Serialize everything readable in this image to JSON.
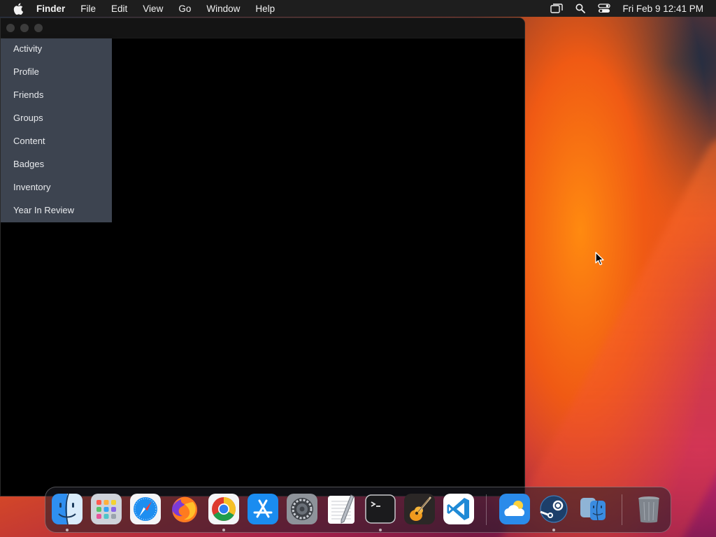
{
  "menubar": {
    "app_name": "Finder",
    "menus": [
      "File",
      "Edit",
      "View",
      "Go",
      "Window",
      "Help"
    ],
    "status_icons": [
      "screen-mirroring-icon",
      "spotlight-search-icon",
      "control-center-icon"
    ],
    "clock": "Fri Feb 9  12:41 PM"
  },
  "window": {
    "traffic_lights": [
      "close",
      "minimize",
      "zoom"
    ],
    "dropdown": {
      "items": [
        "Activity",
        "Profile",
        "Friends",
        "Groups",
        "Content",
        "Badges",
        "Inventory",
        "Year In Review"
      ]
    }
  },
  "dock": {
    "apps": [
      "Finder",
      "Launchpad",
      "Safari",
      "Firefox",
      "Google Chrome",
      "App Store",
      "System Preferences",
      "TextEdit",
      "Terminal",
      "GarageBand",
      "Visual Studio Code",
      "Weather",
      "Steam",
      "Migration Assistant",
      "Trash"
    ],
    "running": [
      "Finder",
      "Google Chrome",
      "Terminal",
      "Steam"
    ]
  },
  "colors": {
    "menubar_bg": "#1e1e1e",
    "dropdown_bg": "#3d4450",
    "window_bg": "#000000"
  }
}
